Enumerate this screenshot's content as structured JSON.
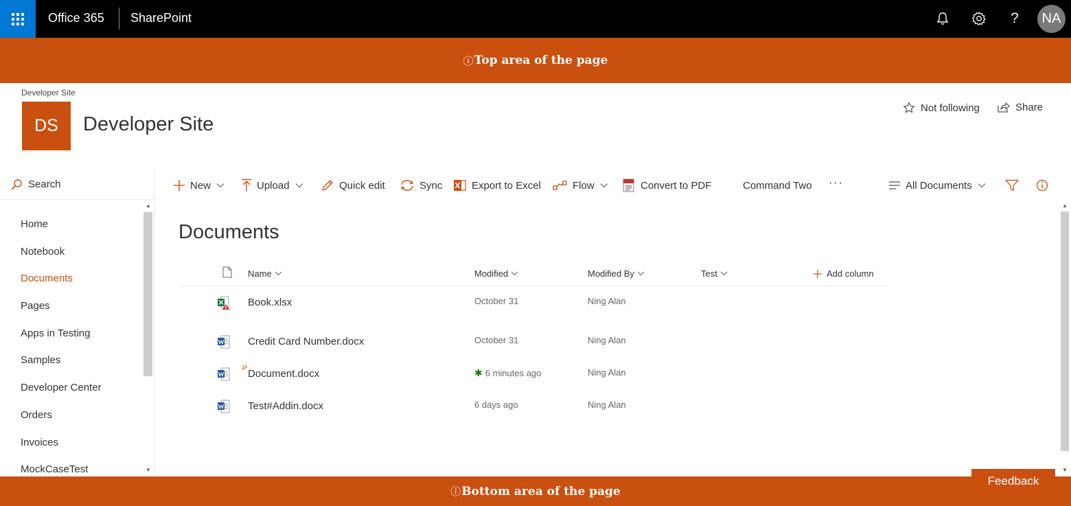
{
  "suite_bar": {
    "brand": "Office 365",
    "app": "SharePoint",
    "user_initials": "NA",
    "help_label": "?"
  },
  "top_placeholder": {
    "icon": "info-icon",
    "text": "Top area of the page"
  },
  "bottom_placeholder": {
    "icon": "info-icon",
    "text": "Bottom area of the page"
  },
  "site": {
    "breadcrumb": "Developer Site",
    "logo_text": "DS",
    "title": "Developer Site",
    "follow_label": "Not following",
    "share_label": "Share"
  },
  "nav": {
    "search_label": "Search",
    "items": [
      "Home",
      "Notebook",
      "Documents",
      "Pages",
      "Apps in Testing",
      "Samples",
      "Developer Center",
      "Orders",
      "Invoices",
      "MockCaseTest"
    ],
    "selected": "Documents"
  },
  "commands": {
    "new": "New",
    "upload": "Upload",
    "quick_edit": "Quick edit",
    "sync": "Sync",
    "export_excel": "Export to Excel",
    "flow": "Flow",
    "convert_pdf": "Convert to PDF",
    "command_two": "Command Two",
    "more": "···",
    "view": "All Documents"
  },
  "library": {
    "title": "Documents",
    "columns": {
      "name": "Name",
      "modified": "Modified",
      "modified_by": "Modified By",
      "test": "Test",
      "add_column": "Add column"
    },
    "rows": [
      {
        "name": "Book.xlsx",
        "modified": "October 31",
        "modified_by": "Ning Alan",
        "icon": "excel-file-warning-icon"
      },
      {
        "name": "Credit Card Number.docx",
        "modified": "October 31",
        "modified_by": "Ning Alan",
        "icon": "word-file-icon"
      },
      {
        "name": "Document.docx",
        "modified": "6 minutes ago",
        "modified_by": "Ning Alan",
        "icon": "word-file-icon",
        "is_new": true
      },
      {
        "name": "Test#Addin.docx",
        "modified": "6 days ago",
        "modified_by": "Ning Alan",
        "icon": "word-file-icon"
      }
    ]
  },
  "feedback_label": "Feedback",
  "colors": {
    "accent": "#ca5010",
    "suite_bar": "#000000",
    "waffle": "#0078d4",
    "new_indicator": "#107c10"
  }
}
